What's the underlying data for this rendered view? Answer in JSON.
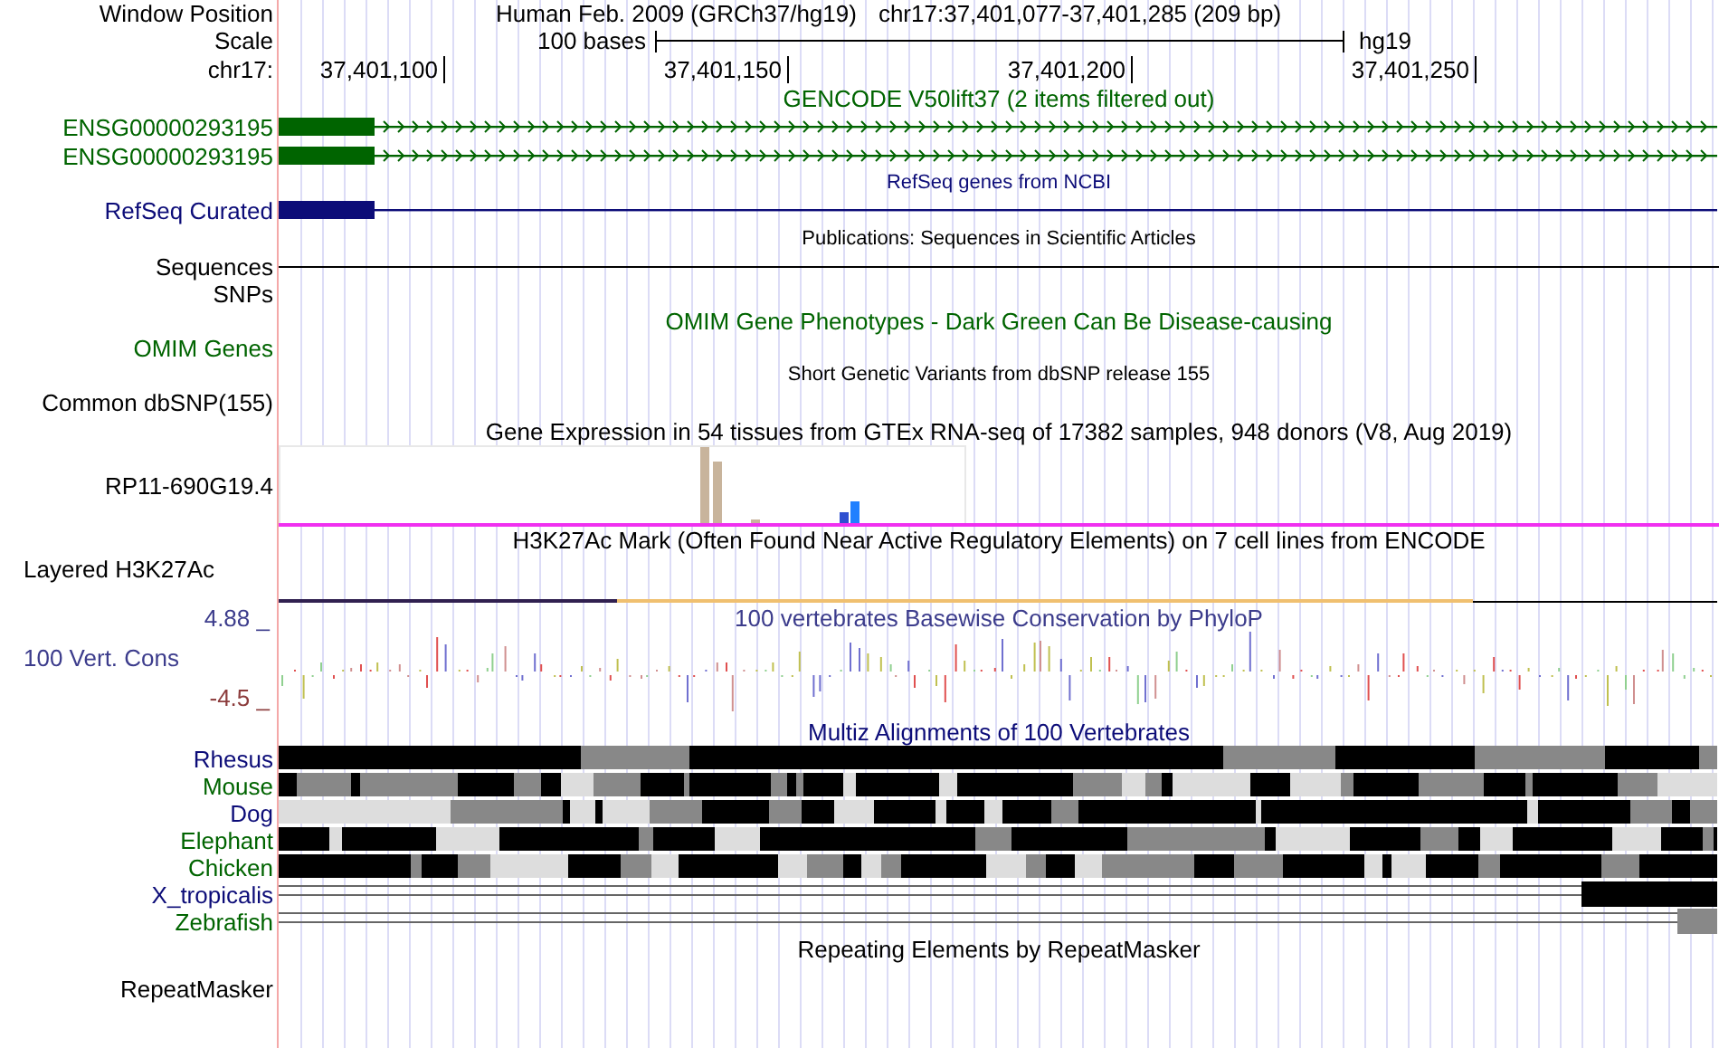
{
  "header": {
    "position_label": "Window Position",
    "assembly": "Human Feb. 2009 (GRCh37/hg19)",
    "position": "chr17:37,401,077-37,401,285 (209 bp)",
    "scale_label": "Scale",
    "scale_length": "100 bases",
    "scale_db": "hg19",
    "chrom_label": "chr17:",
    "ticks": [
      "37,401,100",
      "37,401,150",
      "37,401,200",
      "37,401,250"
    ]
  },
  "tracks": [
    {
      "kind": "gencode",
      "title": "GENCODE V50lift37 (2 items filtered out)",
      "color": "#006400",
      "labels": [
        "ENSG00000293195",
        "ENSG00000293195"
      ]
    },
    {
      "kind": "refseq",
      "title": "RefSeq genes from NCBI",
      "color": "#0c0c78",
      "labels": [
        "RefSeq Curated"
      ]
    },
    {
      "kind": "pubs",
      "title": "Publications: Sequences in Scientific Articles",
      "color": "#000000",
      "labels": [
        "Sequences",
        "SNPs"
      ]
    },
    {
      "kind": "omim",
      "title": "OMIM Gene Phenotypes - Dark Green Can Be Disease-causing",
      "color": "#006400",
      "labels": [
        "OMIM Genes"
      ]
    },
    {
      "kind": "snp",
      "title": "Short Genetic Variants from dbSNP release 155",
      "color": "#000000",
      "labels": [
        "Common dbSNP(155)"
      ]
    },
    {
      "kind": "gtex",
      "title": "Gene Expression in 54 tissues from GTEx RNA-seq of 17382 samples, 948 donors (V8, Aug 2019)",
      "color": "#000000",
      "labels": [
        "RP11-690G19.4"
      ]
    },
    {
      "kind": "h3k27ac",
      "title": "H3K27Ac Mark (Often Found Near Active Regulatory Elements) on 7 cell lines from ENCODE",
      "color": "#000000",
      "labels": [
        "Layered H3K27Ac"
      ]
    },
    {
      "kind": "phylop",
      "title": "100 vertebrates Basewise Conservation by PhyloP",
      "color": "#3c3c8c",
      "labels": [
        "100 Vert. Cons"
      ],
      "max": "4.88 _",
      "min": "-4.5 _"
    },
    {
      "kind": "multiz",
      "title": "Multiz Alignments of 100 Vertebrates",
      "color": "#0c0c78",
      "species": [
        {
          "name": "Rhesus",
          "color": "#0c0c78",
          "kind": "full"
        },
        {
          "name": "Mouse",
          "color": "#006400",
          "kind": "full"
        },
        {
          "name": "Dog",
          "color": "#0c0c78",
          "kind": "full"
        },
        {
          "name": "Elephant",
          "color": "#006400",
          "kind": "full"
        },
        {
          "name": "Chicken",
          "color": "#006400",
          "kind": "full"
        },
        {
          "name": "X_tropicalis",
          "color": "#0c0c78",
          "kind": "partial"
        },
        {
          "name": "Zebrafish",
          "color": "#006400",
          "kind": "partial"
        }
      ]
    },
    {
      "kind": "repeats",
      "title": "Repeating Elements by RepeatMasker",
      "color": "#000000",
      "labels": [
        "RepeatMasker"
      ]
    }
  ]
}
